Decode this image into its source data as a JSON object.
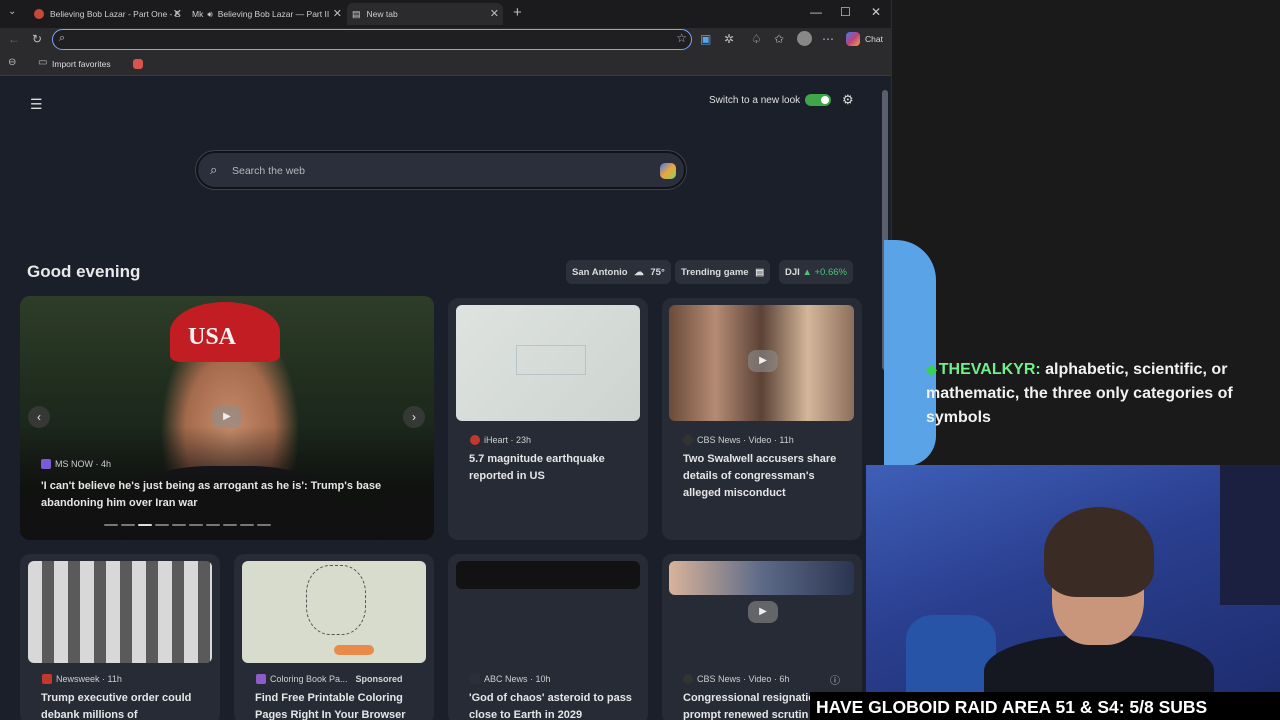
{
  "browser": {
    "tabs": [
      {
        "label": "Believing Bob Lazar - Part One - E",
        "active": false
      },
      {
        "label": "Believing Bob Lazar — Part II",
        "active": false,
        "prefix": "Mk"
      },
      {
        "label": "New tab",
        "active": true
      }
    ],
    "new_tab_symbol": "+",
    "window_controls": {
      "minimize": "—",
      "maximize": "☐",
      "close": "✕"
    },
    "address_value": "",
    "chat_label": "Chat",
    "favorites_bar": {
      "import_label": "Import favorites"
    }
  },
  "newtab": {
    "switch_label": "Switch to a new look",
    "switch_on": true,
    "search_placeholder": "Search the web",
    "greeting": "Good evening",
    "weather": {
      "city": "San Antonio",
      "temp": "75°"
    },
    "trending": "Trending game",
    "stock": {
      "symbol": "DJI",
      "change": "+0.66%"
    },
    "hero": {
      "source": "MS NOW",
      "age": "4h",
      "title": "'I can't believe he's just being as arrogant as he is': Trump's base abandoning him over Iran war",
      "cap_text": "USA",
      "slides": 10,
      "active_slide": 2
    },
    "cards": [
      {
        "source": "iHeart",
        "age": "23h",
        "title": "5.7 magnitude earthquake reported in US"
      },
      {
        "source": "CBS News · Video",
        "age": "11h",
        "title": "Two Swalwell accusers share details of congressman's alleged misconduct"
      },
      {
        "source": "Newsweek",
        "age": "11h",
        "title": "Trump executive order could debank millions of"
      },
      {
        "source": "Coloring Book Pa...",
        "sponsored": "Sponsored",
        "title": "Find Free Printable Coloring Pages Right In Your Browser"
      },
      {
        "source": "ABC News",
        "age": "10h",
        "title": "'God of chaos' asteroid to pass close to Earth in 2029"
      },
      {
        "source": "CBS News · Video",
        "age": "6h",
        "title": "Congressional resignatio prompt renewed scrutin"
      }
    ]
  },
  "chat_overlay": {
    "user": "THEVALKYR",
    "message": "alphabetic, scientific, or mathematic, the three only categories of symbols"
  },
  "banner": "HAVE GLOBOID RAID AREA 51 & S4: 5/8 SUBS",
  "colors": {
    "accent": "#7da6ff",
    "toggle_on": "#3fa64a",
    "chat_user": "#6ff08a",
    "overlay_blue": "#5aa3e6"
  }
}
